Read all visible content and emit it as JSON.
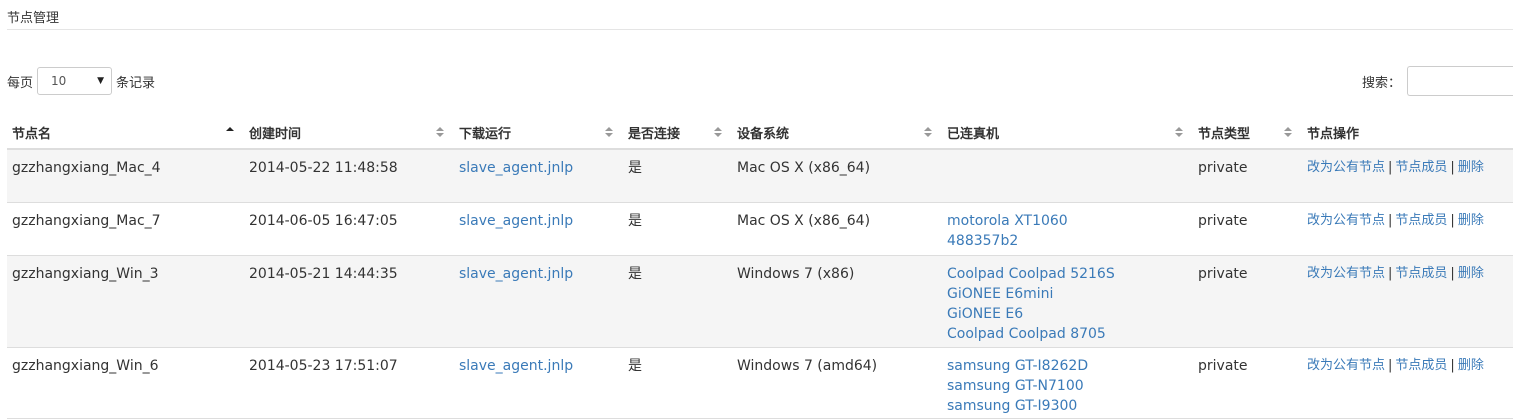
{
  "page": {
    "title": "节点管理"
  },
  "length": {
    "prefix": "每页",
    "value": "10",
    "suffix": "条记录"
  },
  "search": {
    "label": "搜索："
  },
  "table": {
    "headers": [
      "节点名",
      "创建时间",
      "下载运行",
      "是否连接",
      "设备系统",
      "已连真机",
      "节点类型",
      "节点操作"
    ],
    "rows": [
      {
        "name": "gzzhangxiang_Mac_4",
        "created": "2014-05-22 11:48:58",
        "download": "slave_agent.jnlp",
        "connected": "是",
        "os": "Mac OS X (x86_64)",
        "phones": [],
        "type": "private"
      },
      {
        "name": "gzzhangxiang_Mac_7",
        "created": "2014-06-05 16:47:05",
        "download": "slave_agent.jnlp",
        "connected": "是",
        "os": "Mac OS X (x86_64)",
        "phones": [
          "motorola XT1060",
          "488357b2"
        ],
        "type": "private"
      },
      {
        "name": "gzzhangxiang_Win_3",
        "created": "2014-05-21 14:44:35",
        "download": "slave_agent.jnlp",
        "connected": "是",
        "os": "Windows 7 (x86)",
        "phones": [
          "Coolpad Coolpad 5216S",
          "GiONEE E6mini",
          "GiONEE E6",
          "Coolpad Coolpad 8705"
        ],
        "type": "private"
      },
      {
        "name": "gzzhangxiang_Win_6",
        "created": "2014-05-23 17:51:07",
        "download": "slave_agent.jnlp",
        "connected": "是",
        "os": "Windows 7 (amd64)",
        "phones": [
          "samsung GT-I8262D",
          "samsung GT-N7100",
          "samsung GT-I9300"
        ],
        "type": "private"
      }
    ],
    "actions": {
      "make_public": "改为公有节点",
      "members": "节点成员",
      "delete": "删除",
      "separator": "|"
    }
  },
  "colors": {
    "link": "#3a7ab8",
    "stripe": "#f5f5f5",
    "border": "#dddddd"
  }
}
